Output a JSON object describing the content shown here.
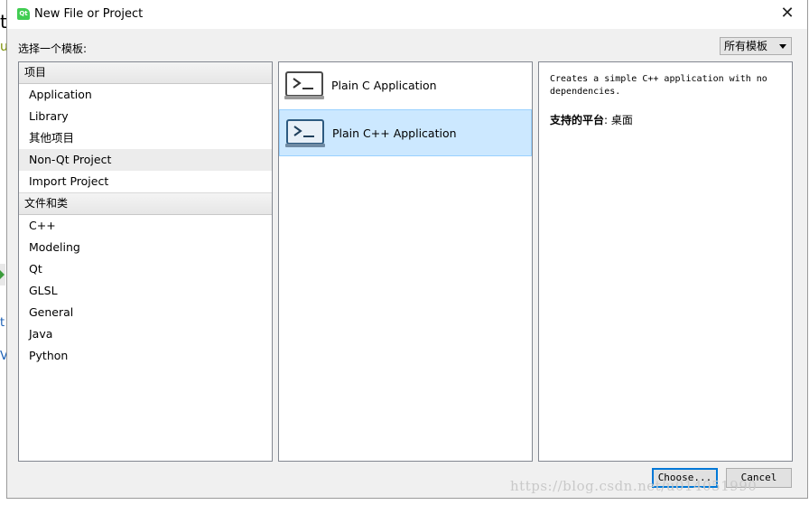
{
  "window": {
    "title": "New File or Project",
    "icon": "qt-logo-icon",
    "close_glyph": "✕"
  },
  "prompt": "选择一个模板:",
  "filter": {
    "selected": "所有模板"
  },
  "categories": [
    {
      "header": "项目",
      "items": [
        "Application",
        "Library",
        "其他项目",
        "Non-Qt Project",
        "Import Project"
      ],
      "selected_index": 3
    },
    {
      "header": "文件和类",
      "items": [
        "C++",
        "Modeling",
        "Qt",
        "GLSL",
        "General",
        "Java",
        "Python"
      ]
    }
  ],
  "templates": [
    {
      "label": "Plain C Application",
      "icon": "terminal-icon"
    },
    {
      "label": "Plain C++ Application",
      "icon": "terminal-icon",
      "selected": true
    }
  ],
  "description": {
    "text_line1": "Creates a simple C++ application with no",
    "text_line2": "dependencies.",
    "platform_label": "支持的平台",
    "platform_value": ": 桌面"
  },
  "buttons": {
    "choose": "Choose...",
    "cancel": "Cancel"
  },
  "colors": {
    "selection": "#cce8ff",
    "selection_border": "#99d1ff",
    "accent": "#0078d7"
  },
  "watermark": "https://blog.csdn.net/u014051990"
}
